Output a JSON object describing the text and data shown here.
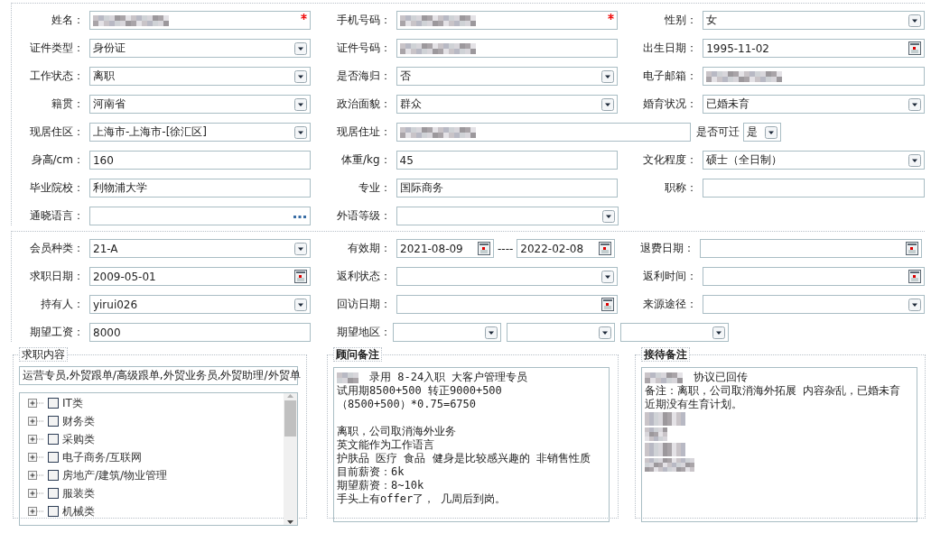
{
  "personal": {
    "rows": [
      {
        "cells": [
          {
            "label": "姓名：",
            "kind": "text",
            "redacted": true,
            "required": true
          },
          {
            "label": "手机号码：",
            "kind": "text",
            "redacted": true,
            "required": true
          },
          {
            "label": "性别：",
            "kind": "select",
            "value": "女"
          }
        ]
      },
      {
        "cells": [
          {
            "label": "证件类型：",
            "kind": "select",
            "value": "身份证"
          },
          {
            "label": "证件号码：",
            "kind": "text",
            "redacted": true
          },
          {
            "label": "出生日期：",
            "kind": "date",
            "value": "1995-11-02"
          }
        ]
      },
      {
        "cells": [
          {
            "label": "工作状态：",
            "kind": "select",
            "value": "离职"
          },
          {
            "label": "是否海归：",
            "kind": "select",
            "value": "否"
          },
          {
            "label": "电子邮箱：",
            "kind": "text",
            "redacted": true
          }
        ]
      },
      {
        "cells": [
          {
            "label": "籍贯：",
            "kind": "select",
            "value": "河南省"
          },
          {
            "label": "政治面貌：",
            "kind": "select",
            "value": "群众"
          },
          {
            "label": "婚育状况：",
            "kind": "select",
            "value": "已婚未育"
          }
        ]
      },
      {
        "cells": [
          {
            "label": "现居住区：",
            "kind": "select",
            "value": "上海市-上海市-[徐汇区]"
          },
          {
            "label": "现居住址：",
            "kind": "text",
            "redacted": true,
            "wide": true
          },
          {
            "label": "是否可迁",
            "kind": "select",
            "value": "是",
            "compact": true
          }
        ]
      },
      {
        "cells": [
          {
            "label": "身高/cm：",
            "kind": "text",
            "value": "160"
          },
          {
            "label": "体重/kg：",
            "kind": "text",
            "value": "45"
          },
          {
            "label": "文化程度：",
            "kind": "select",
            "value": "硕士（全日制）"
          }
        ]
      },
      {
        "cells": [
          {
            "label": "毕业院校：",
            "kind": "text",
            "value": "利物浦大学"
          },
          {
            "label": "专业：",
            "kind": "text",
            "value": "国际商务"
          },
          {
            "label": "职称：",
            "kind": "text"
          }
        ]
      },
      {
        "cells": [
          {
            "label": "通晓语言：",
            "kind": "picker"
          },
          {
            "label": "外语等级：",
            "kind": "select"
          }
        ]
      }
    ]
  },
  "membership": {
    "rows": [
      {
        "cells": [
          {
            "label": "会员种类：",
            "kind": "select",
            "value": "21-A"
          },
          {
            "label": "有效期：",
            "kind": "date_range",
            "values": [
              "2021-08-09",
              "2022-02-08"
            ],
            "separator": "----"
          },
          {
            "label": "退费日期：",
            "kind": "date"
          }
        ]
      },
      {
        "cells": [
          {
            "label": "求职日期：",
            "kind": "date",
            "value": "2009-05-01"
          },
          {
            "label": "返利状态：",
            "kind": "select"
          },
          {
            "label": "返利时间：",
            "kind": "date"
          }
        ]
      },
      {
        "cells": [
          {
            "label": "持有人：",
            "kind": "select",
            "value": "yirui026"
          },
          {
            "label": "回访日期：",
            "kind": "date"
          },
          {
            "label": "来源途径：",
            "kind": "select"
          }
        ]
      },
      {
        "cells": [
          {
            "label": "期望工资：",
            "kind": "text",
            "value": "8000"
          },
          {
            "label": "期望地区：",
            "kind": "multi_select",
            "parts": [
              {
                "kind": "select"
              },
              {
                "kind": "select"
              },
              {
                "kind": "select"
              }
            ]
          }
        ]
      }
    ]
  },
  "job_intent": {
    "legend": "求职内容",
    "summary": "运营专员,外贸跟单/高级跟单,外贸业务员,外贸助理/外贸单",
    "tree": [
      {
        "label": "IT类",
        "checked": false,
        "expanded": false
      },
      {
        "label": "财务类",
        "checked": false,
        "expanded": false
      },
      {
        "label": "采购类",
        "checked": false,
        "expanded": false
      },
      {
        "label": "电子商务/互联网",
        "checked": false,
        "expanded": false
      },
      {
        "label": "房地产/建筑/物业管理",
        "checked": false,
        "expanded": false
      },
      {
        "label": "服装类",
        "checked": false,
        "expanded": false
      },
      {
        "label": "机械类",
        "checked": false,
        "expanded": false
      }
    ]
  },
  "notes": [
    {
      "legend": "顾问备注",
      "paragraphs": [
        [
          {
            "text": "录用  8-24入职  大客户管理专员",
            "redacted": true
          },
          {
            "text": "试用期8500+500 转正9000+500",
            "redacted": false
          },
          {
            "text": "（8500+500）*0.75=6750",
            "redacted": false
          }
        ],
        [
          {
            "text": "离职，公司取消海外业务",
            "redacted": false
          },
          {
            "text": "英文能作为工作语言",
            "redacted": false
          },
          {
            "text": "护肤品 医疗  食品 健身是比较感兴趣的  非销售性质",
            "redacted": false
          },
          {
            "text": "目前薪资：6k",
            "redacted": false
          },
          {
            "text": "期望薪资：8~10k",
            "redacted": false
          },
          {
            "text": "手头上有offer了， 几周后到岗。",
            "redacted": false
          }
        ]
      ]
    },
    {
      "legend": "接待备注",
      "paragraphs": [
        [
          {
            "text": "协议已回传",
            "redacted": true
          },
          {
            "text": "备注：离职，公司取消海外拓展 内容杂乱，已婚未育",
            "redacted": false
          },
          {
            "text": "近期没有生育计划。",
            "redacted": false
          },
          {
            "redacted": true
          },
          {
            "redacted": true
          },
          {
            "redacted": true
          },
          {
            "redacted": true
          }
        ]
      ]
    }
  ]
}
